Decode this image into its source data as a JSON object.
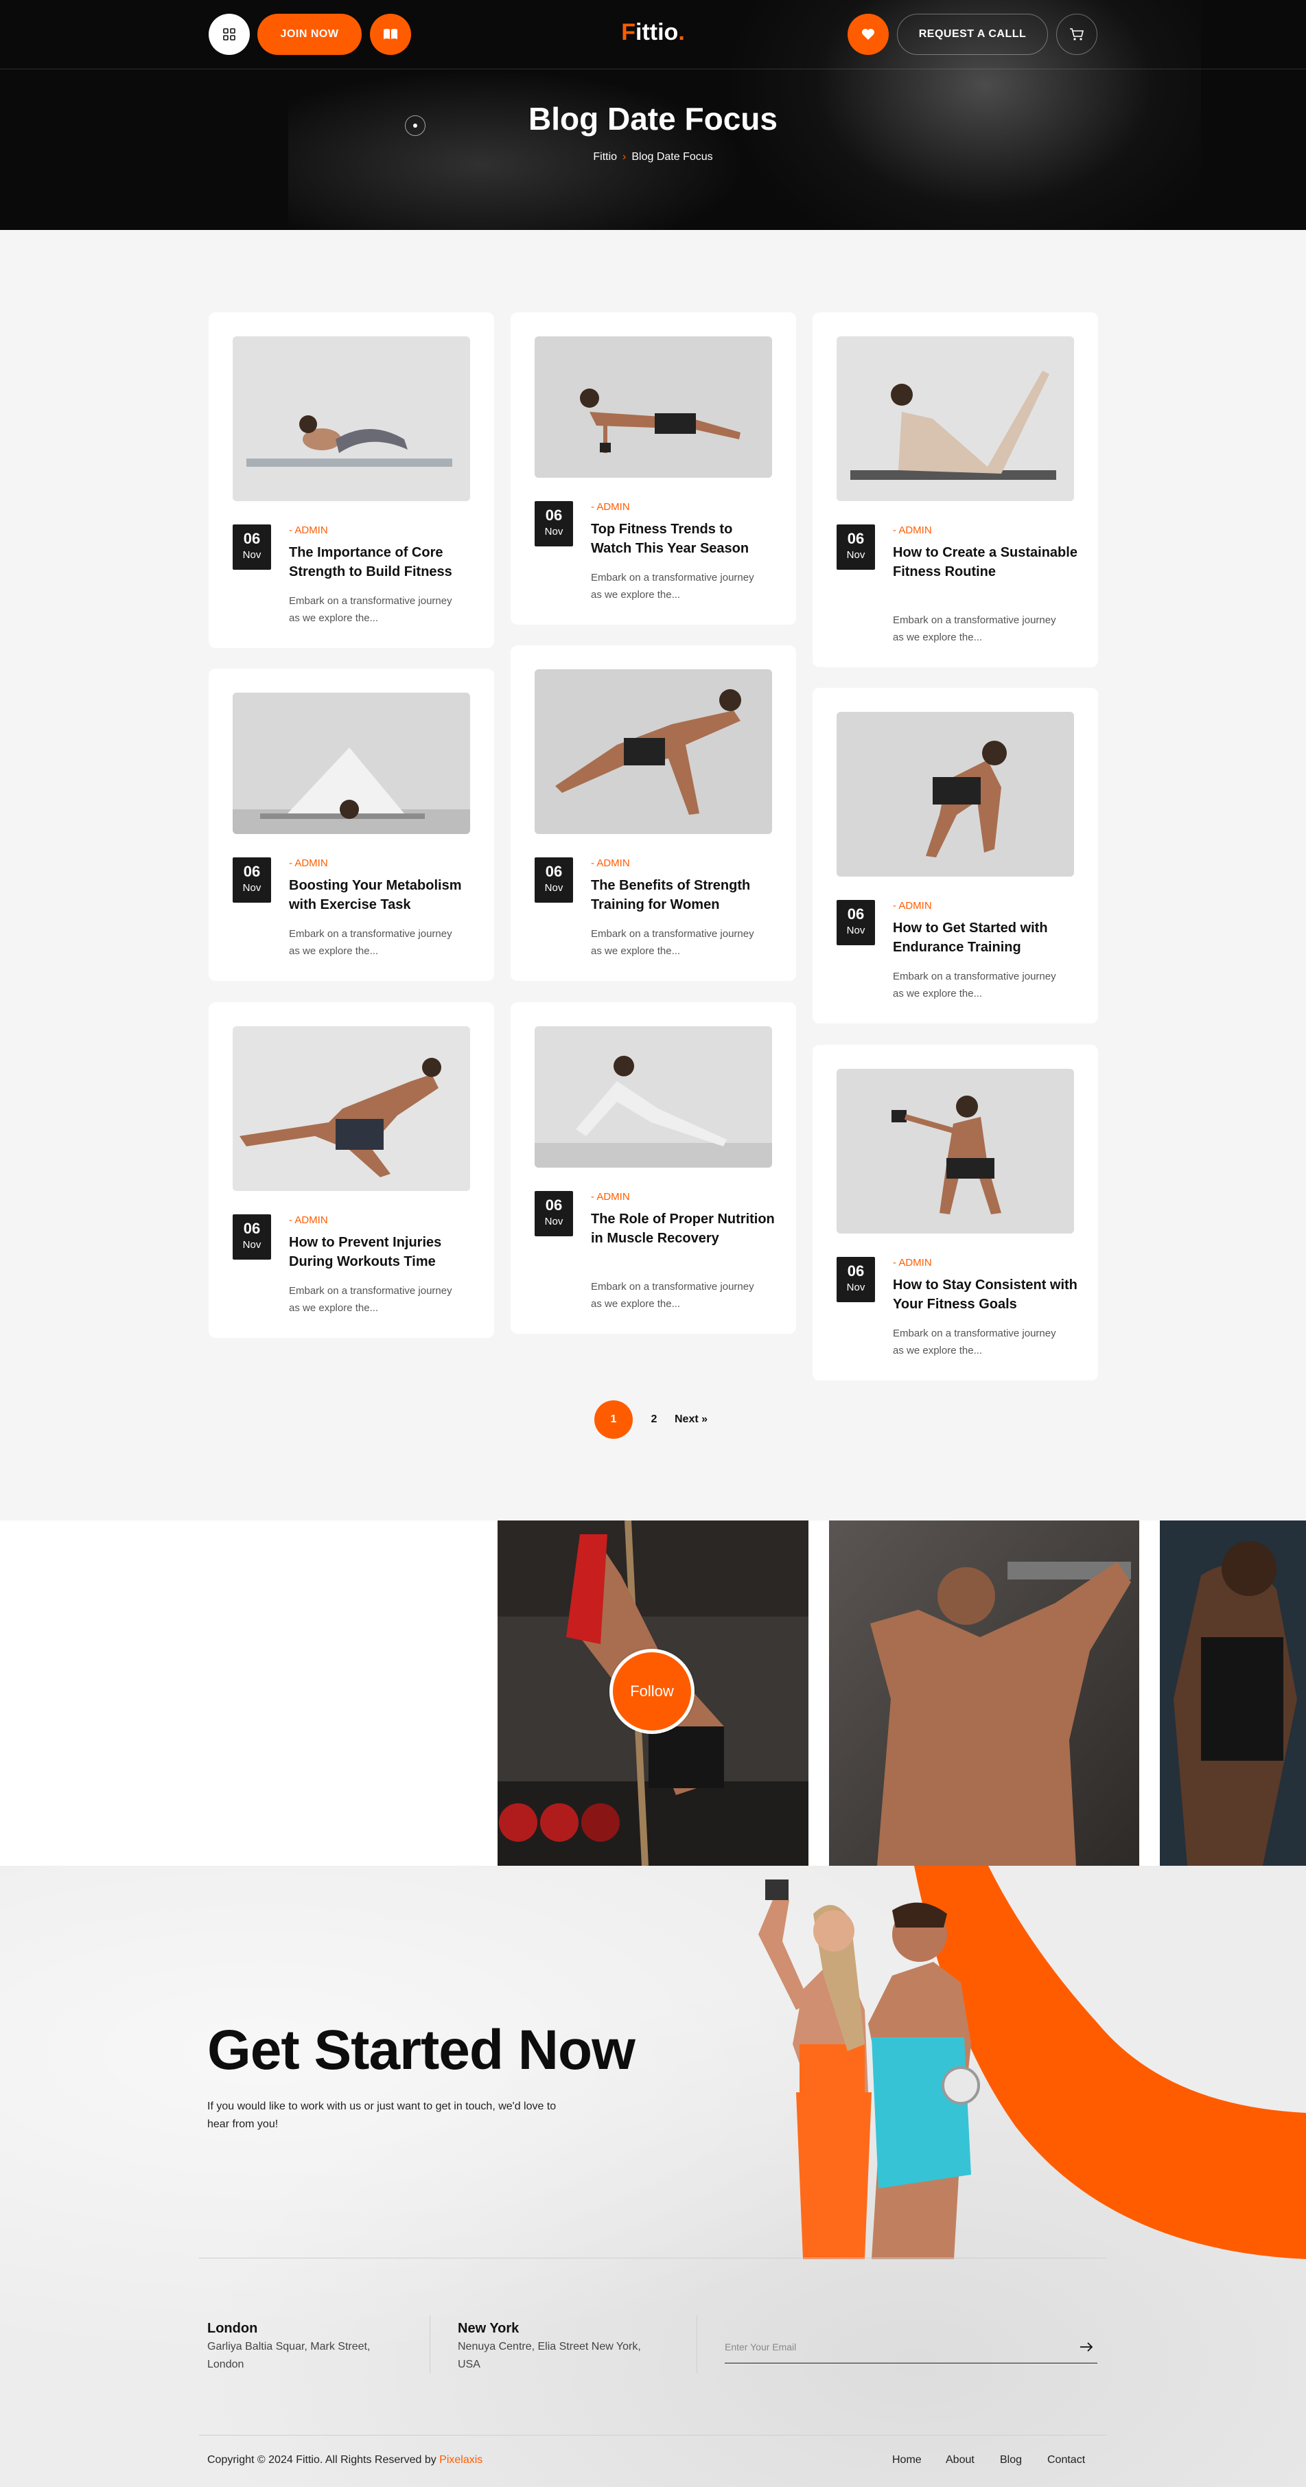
{
  "header": {
    "join_label": "JOIN NOW",
    "logo_f": "F",
    "logo_rest": "ittio",
    "logo_dot": ".",
    "request_label": "REQUEST A CALLL"
  },
  "hero": {
    "title": "Blog Date Focus",
    "breadcrumb_home": "Fittio",
    "breadcrumb_sep": "›",
    "breadcrumb_current": "Blog Date Focus"
  },
  "posts": [
    {
      "day": "06",
      "month": "Nov",
      "author": "- ADMIN",
      "title": "The Importance of Core Strength to Build Fitness",
      "excerpt": "Embark on a transformative journey as we explore the..."
    },
    {
      "day": "06",
      "month": "Nov",
      "author": "- ADMIN",
      "title": "Top Fitness Trends to Watch This Year Season",
      "excerpt": "Embark on a transformative journey as we explore the..."
    },
    {
      "day": "06",
      "month": "Nov",
      "author": "- ADMIN",
      "title": "How to Create a Sustainable Fitness Routine",
      "excerpt": "Embark on a transformative journey as we explore the..."
    },
    {
      "day": "06",
      "month": "Nov",
      "author": "- ADMIN",
      "title": "Boosting Your Metabolism with Exercise Task",
      "excerpt": "Embark on a transformative journey as we explore the..."
    },
    {
      "day": "06",
      "month": "Nov",
      "author": "- ADMIN",
      "title": "The Benefits of Strength Training for Women",
      "excerpt": "Embark on a transformative journey as we explore the..."
    },
    {
      "day": "06",
      "month": "Nov",
      "author": "- ADMIN",
      "title": "How to Get Started with Endurance Training",
      "excerpt": "Embark on a transformative journey as we explore the..."
    },
    {
      "day": "06",
      "month": "Nov",
      "author": "- ADMIN",
      "title": "How to Prevent Injuries During Workouts Time",
      "excerpt": "Embark on a transformative journey as we explore the..."
    },
    {
      "day": "06",
      "month": "Nov",
      "author": "- ADMIN",
      "title": "The Role of Proper Nutrition in Muscle Recovery",
      "excerpt": "Embark on a transformative journey as we explore the..."
    },
    {
      "day": "06",
      "month": "Nov",
      "author": "- ADMIN",
      "title": "How to Stay Consistent with Your Fitness Goals",
      "excerpt": "Embark on a transformative journey as we explore the..."
    }
  ],
  "pagination": {
    "page1": "1",
    "page2": "2",
    "next": "Next »"
  },
  "instagram": {
    "follow_label": "Follow"
  },
  "cta": {
    "title": "Get Started Now",
    "text": "If you would like to work with us or just want to get in touch, we'd love to hear from you!"
  },
  "locations": [
    {
      "city": "London",
      "address": "Garliya Baltia Squar, Mark Street, London"
    },
    {
      "city": "New York",
      "address": "Nenuya Centre, Elia Street New York, USA"
    }
  ],
  "newsletter": {
    "placeholder": "Enter Your Email"
  },
  "footer": {
    "copyright": "Copyright © 2024 Fittio. All Rights Reserved by ",
    "brand": "Pixelaxis",
    "links": [
      "Home",
      "About",
      "Blog",
      "Contact"
    ]
  },
  "colors": {
    "accent": "#ff5c00",
    "dark": "#0a0a0a",
    "card": "#ffffff",
    "bg": "#f5f5f5"
  }
}
